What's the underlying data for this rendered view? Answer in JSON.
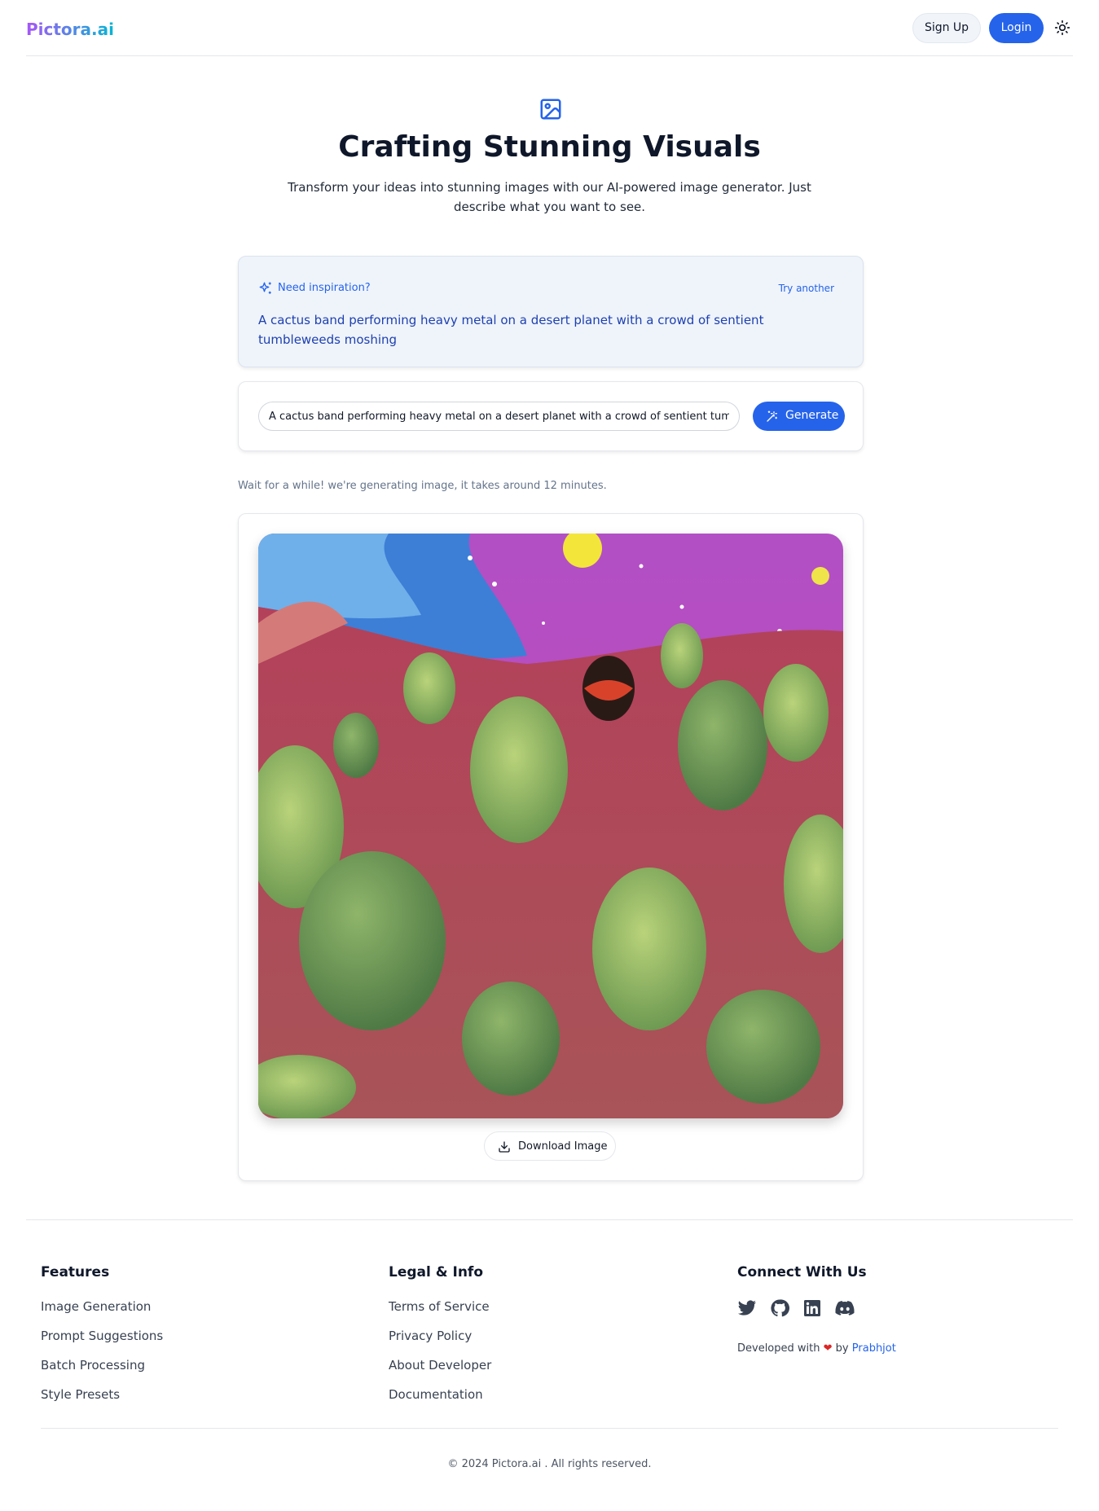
{
  "header": {
    "logo": "Pictora.ai",
    "signup_label": "Sign Up",
    "login_label": "Login",
    "theme_icon": "sun-icon"
  },
  "hero": {
    "icon": "image-icon",
    "title": "Crafting Stunning Visuals",
    "subtitle": "Transform your ideas into stunning images with our AI-powered image generator. Just describe what you want to see."
  },
  "inspiration": {
    "icon": "sparkles-icon",
    "label": "Need inspiration?",
    "try_another": "Try another",
    "prompt": "A cactus band performing heavy metal on a desert planet with a crowd of sentient tumbleweeds moshing"
  },
  "prompt": {
    "value": "A cactus band performing heavy metal on a desert planet with a crowd of sentient tumbleweeds moshing",
    "generate_label": "Generate",
    "generate_icon": "magic-wand-icon"
  },
  "status": {
    "wait_text": "Wait for a while! we're generating image, it takes around 12 minutes."
  },
  "result": {
    "download_label": "Download Image",
    "download_icon": "download-icon"
  },
  "footer": {
    "features": {
      "title": "Features",
      "links": [
        "Image Generation",
        "Prompt Suggestions",
        "Batch Processing",
        "Style Presets"
      ]
    },
    "legal": {
      "title": "Legal & Info",
      "links": [
        "Terms of Service",
        "Privacy Policy",
        "About Developer",
        "Documentation"
      ]
    },
    "connect": {
      "title": "Connect With Us",
      "icons": [
        "twitter-icon",
        "github-icon",
        "linkedin-icon",
        "discord-icon"
      ],
      "dev_prefix": "Developed with",
      "dev_by": "by",
      "dev_name": "Prabhjot"
    },
    "copyright": "© 2024 Pictora.ai . All rights reserved."
  },
  "colors": {
    "primary": "#2563eb",
    "logo_gradient_start": "#a855f7",
    "logo_gradient_end": "#06b6d4",
    "inspiration_bg": "#eff4fb"
  }
}
